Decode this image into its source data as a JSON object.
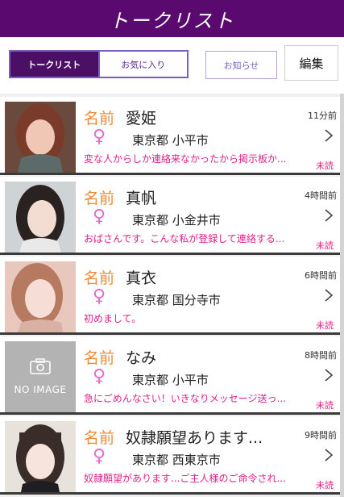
{
  "header": {
    "title": "トークリスト"
  },
  "tabs": {
    "talk_list": "トークリスト",
    "favorites": "お気に入り",
    "notice": "お知らせ",
    "edit": "編集"
  },
  "colors": {
    "header_bg": "#5a0a6e",
    "accent_pink": "#e0218a",
    "name_orange": "#f08a3a",
    "female_pink": "#e36bd6"
  },
  "rows": [
    {
      "name_label": "名前",
      "name": "愛姫",
      "time": "11分前",
      "gender_icon": "♀",
      "location": "東京都 小平市",
      "message": "変な人からしか連絡来なかったから掲示板か...",
      "unread": "未読",
      "avatar": "photo"
    },
    {
      "name_label": "名前",
      "name": "真帆",
      "time": "4時間前",
      "gender_icon": "♀",
      "location": "東京都 小金井市",
      "message": "おばさんです。こんな私が登録して連絡する...",
      "unread": "未読",
      "avatar": "photo"
    },
    {
      "name_label": "名前",
      "name": "真衣",
      "time": "6時間前",
      "gender_icon": "♀",
      "location": "東京都 国分寺市",
      "message": "初めまして。",
      "unread": "未読",
      "avatar": "photo"
    },
    {
      "name_label": "名前",
      "name": "なみ",
      "time": "8時間前",
      "gender_icon": "♀",
      "location": "東京都 小平市",
      "message": "急にごめんなさい！いきなりメッセージ送っ...",
      "unread": "未読",
      "avatar": "no-image",
      "noimage_text": "NO IMAGE"
    },
    {
      "name_label": "名前",
      "name": "奴隷願望あります...",
      "time": "9時間前",
      "gender_icon": "♀",
      "location": "東京都 西東京市",
      "message": "奴隷願望があります...ご主人様のご命令され...",
      "unread": "未読",
      "avatar": "photo"
    }
  ]
}
